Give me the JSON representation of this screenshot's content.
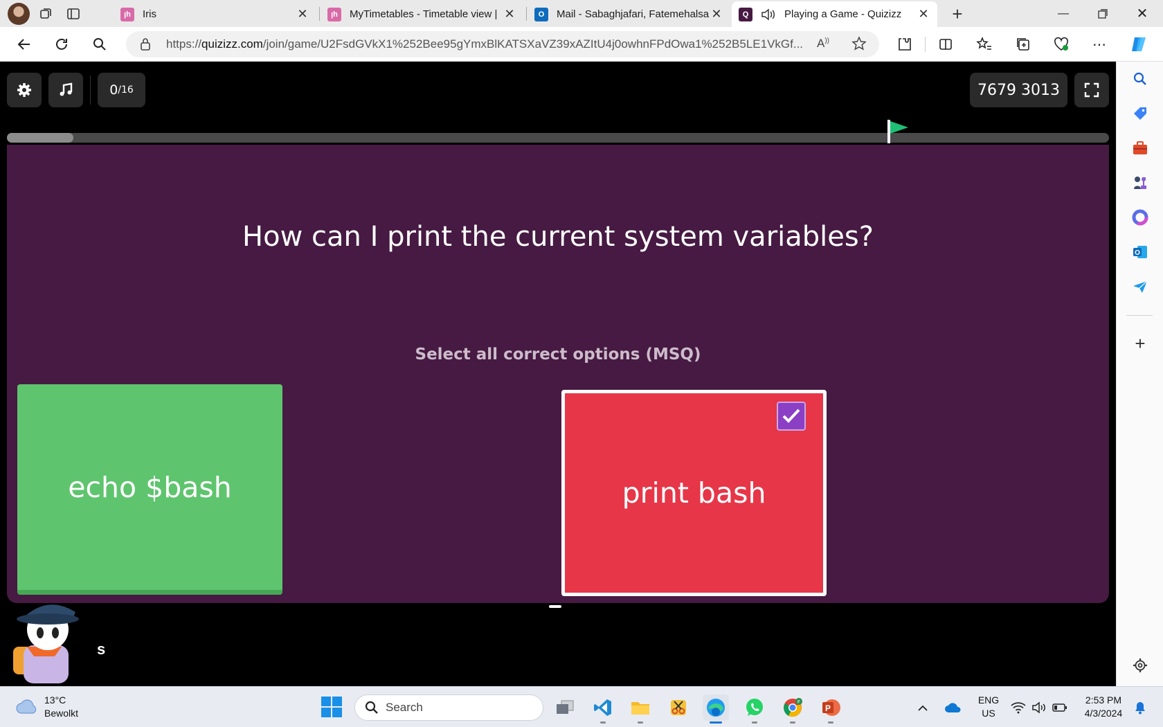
{
  "browser": {
    "tabs": [
      {
        "title": "Iris",
        "favicon": "iris-icon",
        "active": false
      },
      {
        "title": "MyTimetables - Timetable view |",
        "favicon": "iris-icon",
        "active": false
      },
      {
        "title": "Mail - Sabaghjafari, Fatemehalsa...",
        "favicon": "outlook-icon",
        "active": false
      },
      {
        "title": "Playing a Game - Quizizz",
        "favicon": "quizizz-icon",
        "active": true
      }
    ],
    "url_prefix": "https://",
    "url_host": "quizizz.com",
    "url_path": "/join/game/U2FsdGVkX1%252Bee95gYmxBlKATSXaVZ39xAZItU4j0owhnFPdOwa1%252B5LE1VkGf..."
  },
  "game": {
    "counter_current": "0",
    "counter_total": "/16",
    "game_code": "7679 3013",
    "progress": 0.06,
    "flag_position": 0.8,
    "question": "How can I print the current system variables?",
    "instruction": "Select all correct options (MSQ)",
    "options": [
      {
        "text": "echo $bash",
        "color": "#5fc46e",
        "selected": false
      },
      {
        "text": "print bash",
        "color": "#e63648",
        "selected": true
      }
    ],
    "player_name": "s",
    "colors": {
      "card_bg": "#461a42",
      "flag": "#1fbf75",
      "check": "#8b3fc4"
    }
  },
  "taskbar": {
    "temperature": "13°C",
    "weather_desc": "Bewolkt",
    "search_placeholder": "Search",
    "lang_top": "ENG",
    "lang_bottom": "US",
    "time": "2:53 PM",
    "date": "4/3/2024"
  }
}
